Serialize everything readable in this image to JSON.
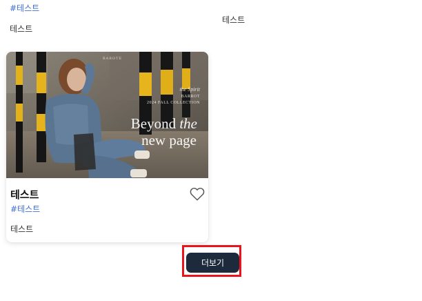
{
  "top_card": {
    "hashtag": "#테스트",
    "description": "테스트",
    "right_text": "테스트"
  },
  "product_card": {
    "image": {
      "brand": "BAROTE",
      "tag_line_a": "the Spirit",
      "tag_line_b": "BARROT",
      "tag_line_c": "2024 FALL COLLECTION",
      "headline_1a": "Beyond ",
      "headline_1b": "the",
      "headline_2": "new page"
    },
    "title": "테스트",
    "hashtag": "#테스트",
    "description": "테스트",
    "favorite_icon": "heart-outline-icon"
  },
  "more_button": {
    "label": "더보기"
  },
  "colors": {
    "hashtag": "#3f6fd8",
    "button_bg": "#1c2a3c",
    "highlight": "#e8141b"
  }
}
